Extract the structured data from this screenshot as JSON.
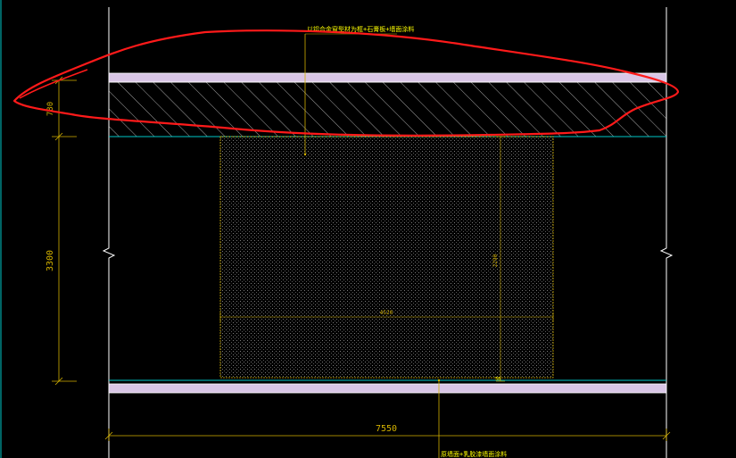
{
  "drawing": {
    "colors": {
      "background": "#000000",
      "wall_line": "#ffffff",
      "slab_fill": "#d9c6e6",
      "cyan_line": "#00c8c8",
      "dimension": "#d4b200",
      "note_text": "#ffff00",
      "hatch": "#cfcfcf",
      "infill_dots": "#7d7d7d",
      "markup": "#ff1a1a"
    },
    "dimensions": {
      "overall_height": "3300",
      "slab_thickness": "780",
      "total_width": "7550",
      "opening_width": "4520",
      "opening_height": "2290",
      "small_tag": "50"
    },
    "annotations": {
      "top_note": "以铝合金窗型材为框+石膏板+墙面涂料",
      "bottom_note": "原墙面+乳胶漆墙面涂料"
    }
  }
}
